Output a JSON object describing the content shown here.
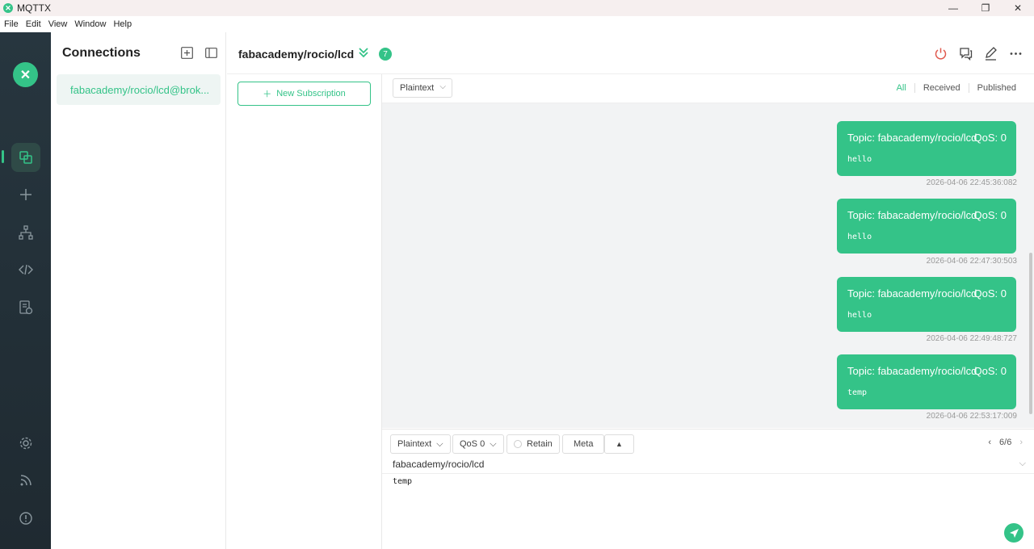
{
  "window": {
    "title": "MQTTX",
    "controls": {
      "minimize": "—",
      "maximize": "❐",
      "close": "✕"
    }
  },
  "menu": [
    "File",
    "Edit",
    "View",
    "Window",
    "Help"
  ],
  "sidebar": {
    "icons": [
      "connections-icon",
      "add-icon",
      "topology-icon",
      "script-icon",
      "log-icon",
      "settings-icon",
      "feed-icon",
      "about-icon"
    ],
    "active": "connections-icon"
  },
  "connections": {
    "title": "Connections",
    "items": [
      {
        "label": "fabacademy/rocio/lcd@brok..."
      }
    ]
  },
  "header": {
    "topic": "fabacademy/rocio/lcd",
    "count": "7"
  },
  "subscriptions": {
    "new_button": "New Subscription"
  },
  "message_toolbar": {
    "format": "Plaintext",
    "filters": [
      "All",
      "Received",
      "Published"
    ],
    "active_filter": "All"
  },
  "messages": [
    {
      "topic": "Topic: fabacademy/rocio/lcd",
      "qos": "QoS: 0",
      "payload": "hello",
      "time": "2026-04-06 22:45:36:082"
    },
    {
      "topic": "Topic: fabacademy/rocio/lcd",
      "qos": "QoS: 0",
      "payload": "hello",
      "time": "2026-04-06 22:47:30:503"
    },
    {
      "topic": "Topic: fabacademy/rocio/lcd",
      "qos": "QoS: 0",
      "payload": "hello",
      "time": "2026-04-06 22:49:48:727"
    },
    {
      "topic": "Topic: fabacademy/rocio/lcd",
      "qos": "QoS: 0",
      "payload": "temp",
      "time": "2026-04-06 22:53:17:009"
    }
  ],
  "publish": {
    "format": "Plaintext",
    "qos": "QoS 0",
    "retain": "Retain",
    "meta": "Meta",
    "pager": "6/6",
    "topic": "fabacademy/rocio/lcd",
    "payload": "temp"
  },
  "colors": {
    "accent": "#34c388",
    "sidebar": "#27363f"
  }
}
